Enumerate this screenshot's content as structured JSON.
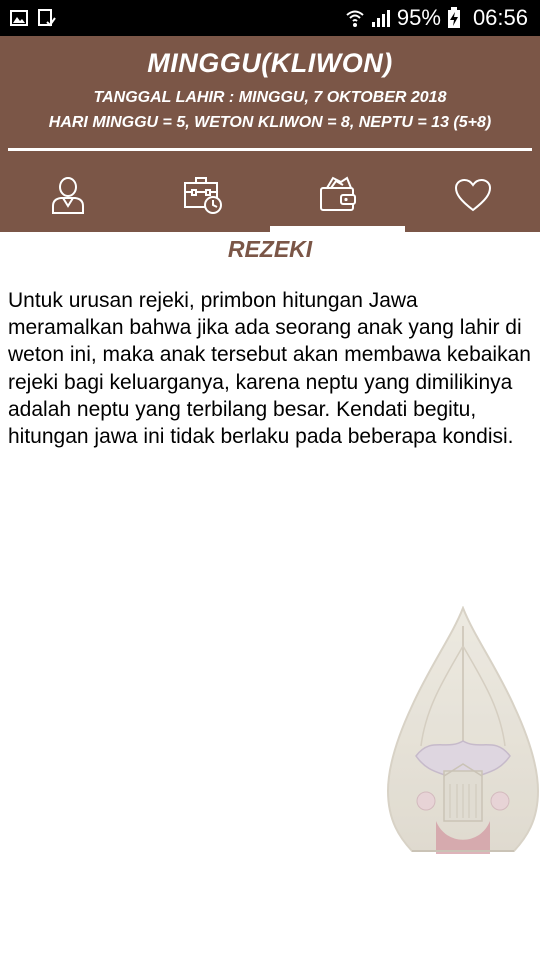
{
  "status_bar": {
    "battery": "95%",
    "time": "06:56"
  },
  "header": {
    "title": "MINGGU(KLIWON)",
    "birth_date": "TANGGAL LAHIR : MINGGU, 7 OKTOBER 2018",
    "calculation": "HARI MINGGU = 5, WETON KLIWON = 8, NEPTU = 13 (5+8)"
  },
  "tabs": [
    {
      "icon": "person-icon",
      "selected": false
    },
    {
      "icon": "briefcase-clock-icon",
      "selected": false
    },
    {
      "icon": "wallet-icon",
      "selected": true
    },
    {
      "icon": "heart-icon",
      "selected": false
    }
  ],
  "content": {
    "section_title": "REZEKI",
    "paragraph": "Untuk urusan rejeki, primbon hitungan Jawa meramalkan bahwa jika ada seorang anak yang lahir di weton ini, maka anak tersebut akan membawa kebaikan rejeki bagi keluarganya, karena neptu yang dimilikinya adalah neptu yang terbilang besar. Kendati begitu, hitungan jawa ini tidak berlaku pada beberapa kondisi."
  },
  "colors": {
    "header_bg": "#7b5647",
    "status_bar_bg": "#000000",
    "accent_text": "#7b5647"
  }
}
